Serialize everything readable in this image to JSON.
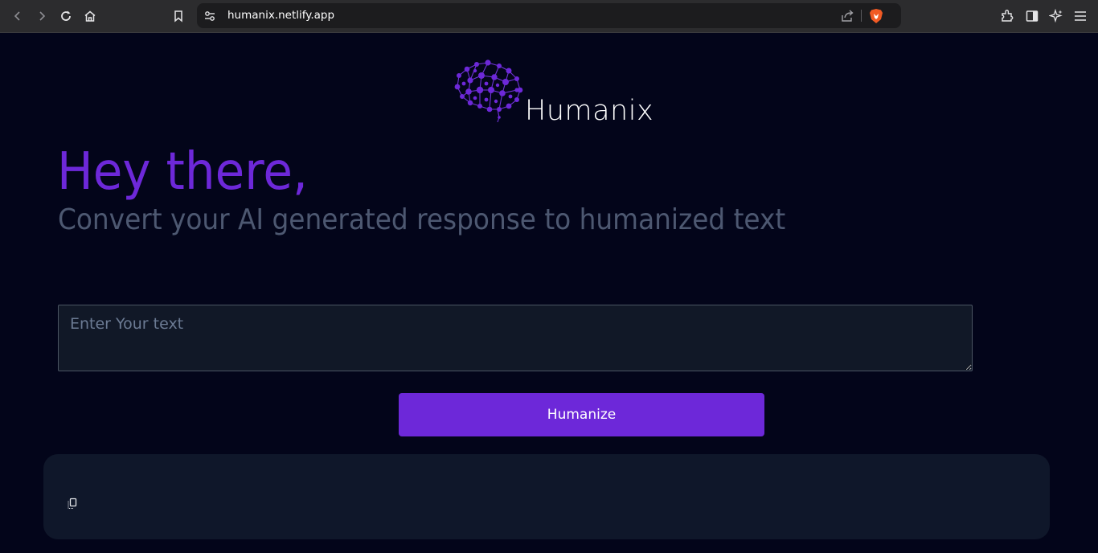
{
  "browser": {
    "url_host": "humanix.netlify.app"
  },
  "brand": {
    "name": "Humanix",
    "logo_icon": "brain-network-icon",
    "accent_color": "#6d28d9"
  },
  "hero": {
    "greeting": "Hey there,",
    "subtitle": "Convert your AI generated response to humanized text"
  },
  "input": {
    "placeholder": "Enter Your text",
    "value": ""
  },
  "action": {
    "button_label": "Humanize"
  },
  "output": {
    "copy_icon": "copy-icon",
    "text": ""
  }
}
